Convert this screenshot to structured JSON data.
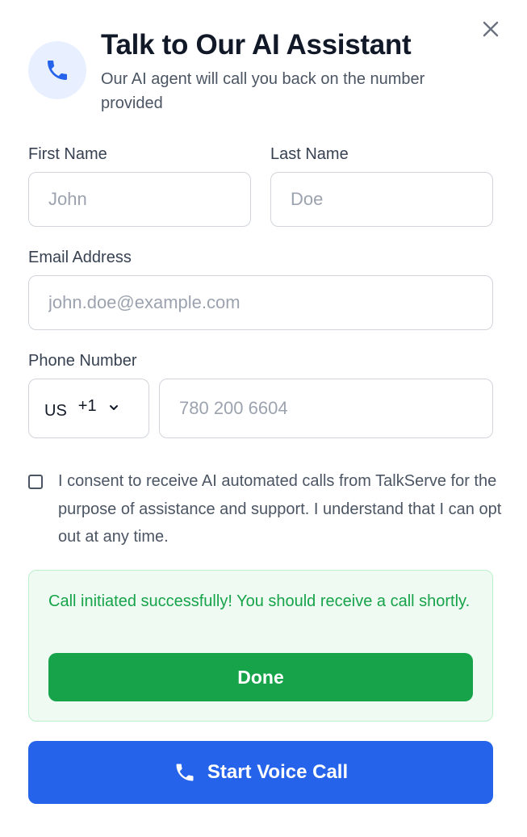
{
  "header": {
    "title": "Talk to Our AI Assistant",
    "subtitle": "Our AI agent will call you back on the number provided",
    "icon": "phone-icon",
    "close_icon": "close-icon"
  },
  "form": {
    "first_name": {
      "label": "First Name",
      "placeholder": "John",
      "value": ""
    },
    "last_name": {
      "label": "Last Name",
      "placeholder": "Doe",
      "value": ""
    },
    "email": {
      "label": "Email Address",
      "placeholder": "john.doe@example.com",
      "value": ""
    },
    "phone": {
      "label": "Phone Number",
      "country": "US",
      "dial_code": "+1",
      "placeholder": "780 200 6604",
      "value": ""
    },
    "consent": {
      "checked": false,
      "text": "I consent to receive AI automated calls from TalkServe for the purpose of assistance and support. I understand that I can opt out at any time."
    }
  },
  "success": {
    "message": "Call initiated successfully! You should receive a call shortly.",
    "done_label": "Done"
  },
  "start_call": {
    "label": "Start Voice Call",
    "icon": "phone-icon"
  },
  "colors": {
    "primary": "#2563eb",
    "success": "#16a34a",
    "success_bg": "#effbf2",
    "icon_bg": "#e8efff"
  }
}
